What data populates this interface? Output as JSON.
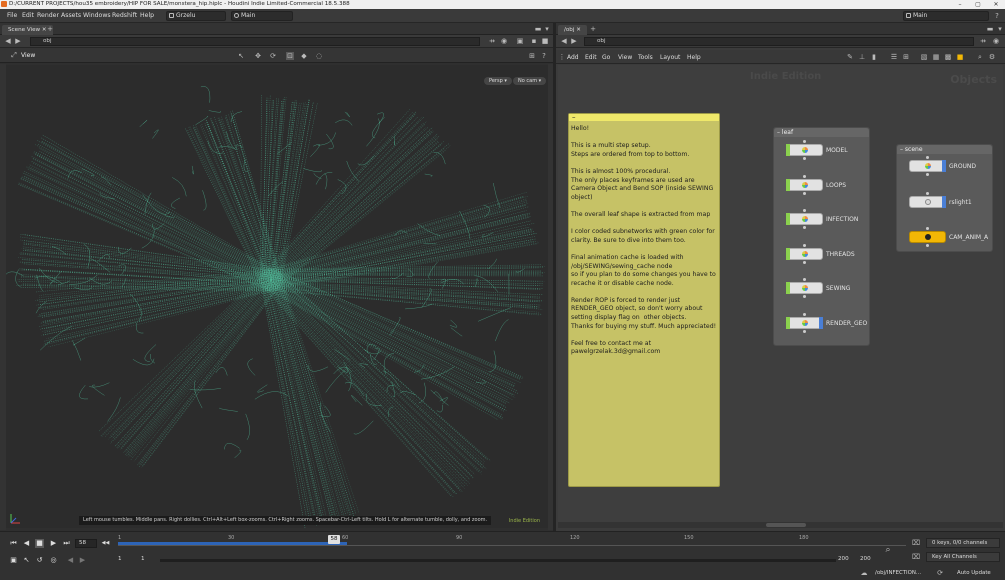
{
  "window": {
    "title": "D:/CURRENT PROJECTS/hou35 embroidery/HIP FOR SALE/monstera_hip.hiplc - Houdini Indie Limited-Commercial 18.5.388",
    "controls": [
      "–",
      "▢",
      "✕"
    ]
  },
  "menubar": {
    "items": [
      "File",
      "Edit",
      "Render",
      "Assets",
      "Windows",
      "Redshift",
      "Help"
    ],
    "shelf_set": "Grzelu",
    "desktop": "Main",
    "right_desktop": "Main"
  },
  "scene_view": {
    "tab_label": "Scene View",
    "add_tab": "+",
    "path": "obj",
    "view_label": "View",
    "persp_label": "Persp ▾",
    "cam_label": "No cam ▾",
    "hint_text": "Left mouse tumbles. Middle pans. Right dollies. Ctrl+Alt+Left box-zooms. Ctrl+Right zooms. Spacebar-Ctrl-Left tilts. Hold L for alternate tumble, dolly, and zoom.",
    "watermark": "Indie Edition"
  },
  "network": {
    "tab_label": "/obj",
    "add_tab": "+",
    "path": "obj",
    "menu": [
      "Add",
      "Edit",
      "Go",
      "View",
      "Tools",
      "Layout",
      "Help"
    ],
    "watermark": "Indie Edition",
    "context_label": "Objects",
    "sticky_note": {
      "collapse": "–",
      "text": "Hello!\n\nThis is a multi step setup.\nSteps are ordered from top to bottom.\n\nThis is almost 100% procedural.\nThe only places keyframes are used are Camera Object and Bend SOP (inside SEWING object)\n\nThe overall leaf shape is extracted from map\n\nI color coded subnetworks with green color for clarity. Be sure to dive into them too.\n\nFinal animation cache is loaded with /obj/SEWING/sewing_cache node\nso if you plan to do some changes you have to recache it or disable cache node.\n\nRender ROP is forced to render just RENDER_GEO object, so don't worry about setting display flag on  other objects.\nThanks for buying my stuff. Much appreciated!\n\nFeel free to contact me at\npawelgrzelak.3d@gmail.com"
    },
    "leaf_box": {
      "title": "leaf",
      "nodes": [
        "MODEL",
        "LOOPS",
        "INFECTION",
        "THREADS",
        "SEWING",
        "RENDER_GEO"
      ]
    },
    "scene_box": {
      "title": "scene",
      "nodes": [
        "GROUND",
        "rslight1",
        "CAM_ANIM_A"
      ]
    }
  },
  "timeline": {
    "current_frame": "58",
    "cursor_frame": "58",
    "ticks": [
      "1",
      "30",
      "60",
      "90",
      "120",
      "150",
      "180"
    ],
    "start_frame": "1",
    "start_frame2": "1",
    "end_frame": "200",
    "end_frame2": "200",
    "progress": 0.29,
    "keys_label": "0 keys, 0/0 channels",
    "key_all_label": "Key All Channels",
    "status_path": "/obj/INFECTION...",
    "auto_update": "Auto Update"
  },
  "colors": {
    "mesh": "#55c9a4",
    "sticky": "#c6c266",
    "playbar": "#2d64b7",
    "green_flag": "#8bd14e",
    "blue_flag": "#4a7fd6",
    "yellow_node": "#f2b705"
  }
}
